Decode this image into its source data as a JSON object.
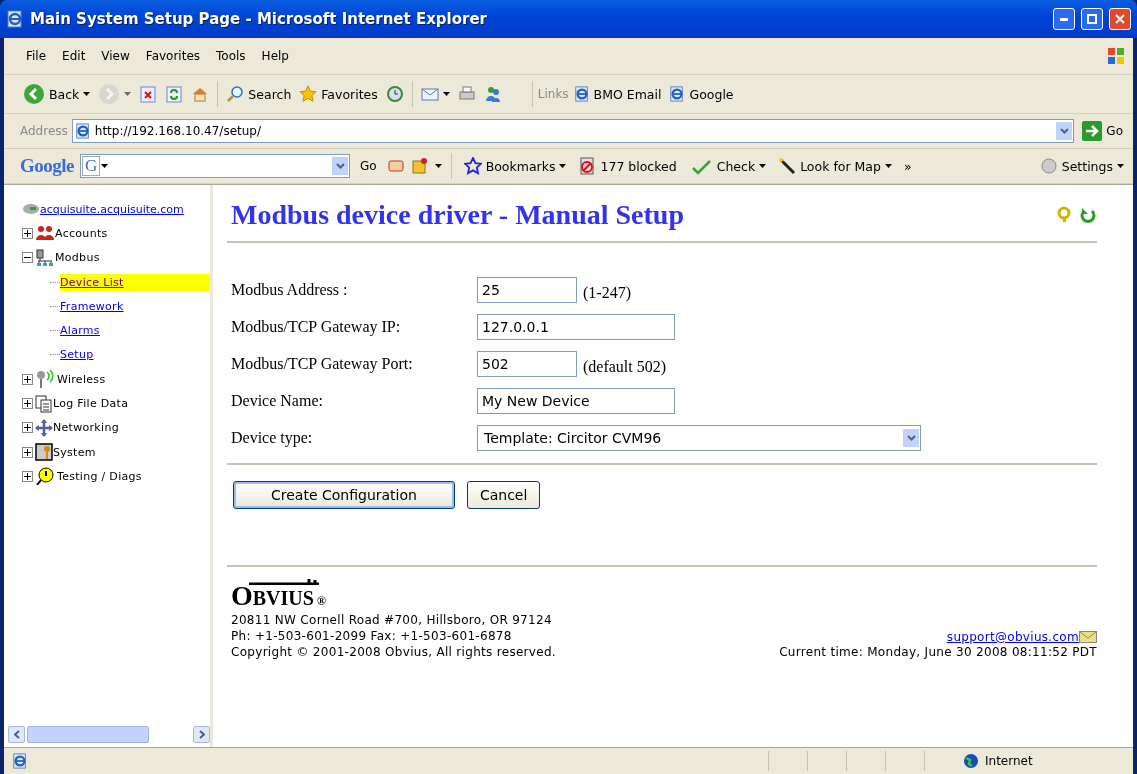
{
  "window": {
    "title": "Main System Setup Page - Microsoft Internet Explorer"
  },
  "menu": [
    {
      "label": "File"
    },
    {
      "label": "Edit"
    },
    {
      "label": "View"
    },
    {
      "label": "Favorites"
    },
    {
      "label": "Tools"
    },
    {
      "label": "Help"
    }
  ],
  "toolbar": [
    {
      "kind": "back",
      "label": "Back",
      "dropdown": true,
      "disabled": false
    },
    {
      "kind": "forward",
      "dropdown": true,
      "disabled": true
    },
    {
      "kind": "stop",
      "dropdown": false,
      "disabled": false
    },
    {
      "kind": "refresh",
      "dropdown": false,
      "disabled": false
    },
    {
      "kind": "home",
      "dropdown": false,
      "disabled": false
    },
    {
      "kind": "search",
      "label": "Search",
      "dropdown": false,
      "disabled": false
    },
    {
      "kind": "favorites",
      "label": "Favorites",
      "dropdown": false,
      "disabled": false
    },
    {
      "kind": "history",
      "dropdown": false,
      "disabled": false
    },
    {
      "kind": "mail",
      "dropdown": true,
      "disabled": false
    },
    {
      "kind": "print",
      "dropdown": false,
      "disabled": false
    },
    {
      "kind": "messenger",
      "dropdown": false,
      "disabled": false
    }
  ],
  "links": {
    "label": "Links",
    "items": [
      {
        "label": "BMO Email"
      },
      {
        "label": "Google"
      }
    ]
  },
  "address": {
    "label": "Address",
    "value": "http://192.168.10.47/setup/",
    "go": "Go"
  },
  "google_bar": {
    "logo": "Google",
    "search_letter": "G",
    "go": "Go",
    "items": [
      {
        "kind": "bookmarks",
        "label": "Bookmarks",
        "dropdown": true
      },
      {
        "kind": "blocked",
        "label": "177 blocked",
        "dropdown": false
      },
      {
        "kind": "check",
        "label": "Check",
        "dropdown": true
      },
      {
        "kind": "map",
        "label": "Look for Map",
        "dropdown": true
      }
    ],
    "more": "»",
    "settings": "Settings"
  },
  "sidebar": {
    "root": "acquisuite.acquisuite.com",
    "items": [
      {
        "kind": "accounts",
        "label": "Accounts",
        "expanded": false
      },
      {
        "kind": "modbus",
        "label": "Modbus",
        "expanded": true,
        "children": [
          {
            "label": "Device List",
            "selected": true
          },
          {
            "label": "Framework",
            "selected": false
          },
          {
            "label": "Alarms",
            "selected": false
          },
          {
            "label": "Setup",
            "selected": false
          }
        ]
      },
      {
        "kind": "wireless",
        "label": "Wireless",
        "expanded": false
      },
      {
        "kind": "logfile",
        "label": "Log File Data",
        "expanded": false
      },
      {
        "kind": "networking",
        "label": "Networking",
        "expanded": false
      },
      {
        "kind": "system",
        "label": "System",
        "expanded": false
      },
      {
        "kind": "testing",
        "label": "Testing / Diags",
        "expanded": false
      }
    ]
  },
  "page": {
    "heading": "Modbus device driver - Manual Setup",
    "fields": [
      {
        "kind": "short",
        "label": "Modbus Address :",
        "value": "25",
        "hint": "(1-247)"
      },
      {
        "kind": "long",
        "label": "Modbus/TCP Gateway IP:",
        "value": "127.0.0.1"
      },
      {
        "kind": "short",
        "label": "Modbus/TCP Gateway Port:",
        "value": "502",
        "hint": "(default 502)"
      },
      {
        "kind": "long",
        "label": "Device Name:",
        "value": "My New Device"
      },
      {
        "kind": "select",
        "label": "Device type:",
        "value": "Template: Circitor CVM96"
      }
    ],
    "buttons": [
      {
        "label": "Create Configuration",
        "default": true
      },
      {
        "label": "Cancel",
        "default": false
      }
    ],
    "footer": {
      "logo_first": "O",
      "logo_rest": "BVIUS",
      "logo_mark": "®",
      "address": "20811 NW Cornell Road #700, Hillsboro, OR 97124",
      "phone": "Ph: +1-503-601-2099 Fax: +1-503-601-6878",
      "copyright": "Copyright © 2001-2008 Obvius, All rights reserved.",
      "support": "support@obvius.com",
      "time": "Current time: Monday, June 30 2008 08:11:52 PDT"
    }
  },
  "status_bar": {
    "zone": "Internet"
  }
}
